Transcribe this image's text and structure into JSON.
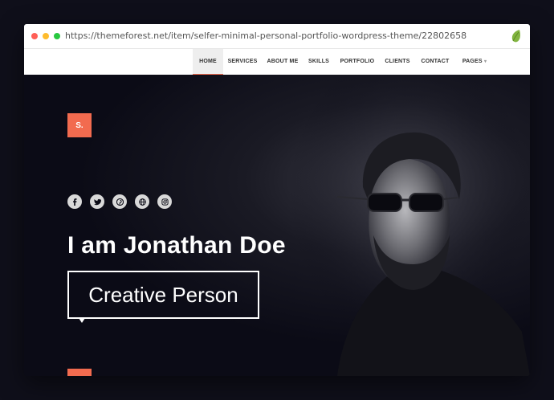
{
  "browser": {
    "url": "https://themeforest.net/item/selfer-minimal-personal-portfolio-wordpress-theme/22802658",
    "brand_icon": "envato-leaf-icon"
  },
  "nav": {
    "items": [
      {
        "label": "HOME",
        "active": true
      },
      {
        "label": "SERVICES"
      },
      {
        "label": "ABOUT ME"
      },
      {
        "label": "SKILLS"
      },
      {
        "label": "PORTFOLIO"
      },
      {
        "label": "CLIENTS"
      },
      {
        "label": "CONTACT"
      },
      {
        "label": "PAGES"
      }
    ]
  },
  "hero": {
    "logo": "S.",
    "name": "I am Jonathan Doe",
    "role": "Creative Person",
    "socials": [
      "facebook-icon",
      "twitter-icon",
      "pinterest-icon",
      "globe-icon",
      "instagram-icon"
    ],
    "scroll_icon": "arrow-down-icon"
  },
  "colors": {
    "accent": "#f26b4f",
    "background": "#0b0b16",
    "text": "#ffffff"
  }
}
